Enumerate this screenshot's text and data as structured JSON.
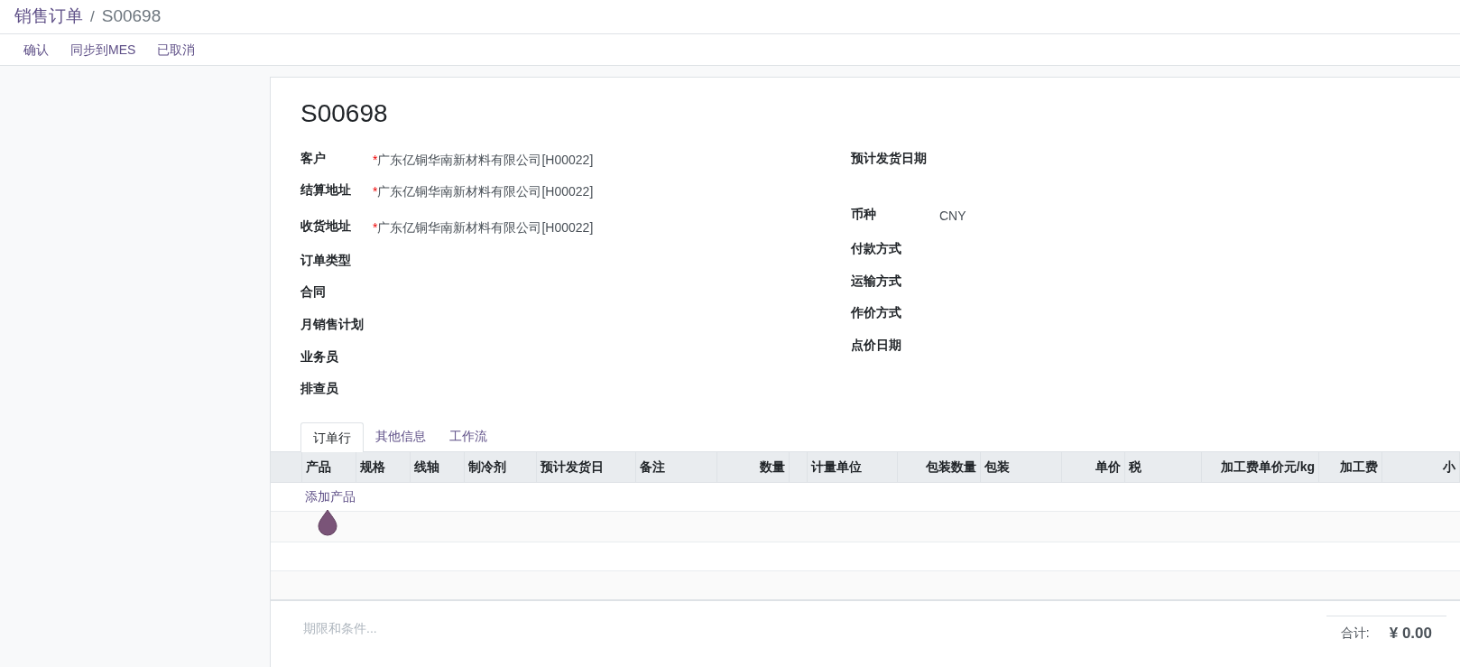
{
  "breadcrumb": {
    "parent": "销售订单",
    "separator": "/",
    "current": "S00698"
  },
  "actions": [
    "确认",
    "同步到MES",
    "已取消"
  ],
  "title": "S00698",
  "left_fields": [
    {
      "label": "客户",
      "required_mark": "*",
      "value": "广东亿铜华南新材料有限公司[H00022]"
    },
    {
      "label": "结算地址",
      "required_mark": "*",
      "value": "广东亿铜华南新材料有限公司[H00022]"
    },
    {
      "label": "收货地址",
      "required_mark": "*",
      "value": "广东亿铜华南新材料有限公司[H00022]"
    },
    {
      "label": "订单类型"
    },
    {
      "label": "合同"
    },
    {
      "label": "月销售计划"
    },
    {
      "label": "业务员"
    },
    {
      "label": "排查员"
    }
  ],
  "right_fields": [
    {
      "label": "预计发货日期"
    },
    {
      "label": "币种",
      "value": "CNY"
    },
    {
      "label": "付款方式"
    },
    {
      "label": "运输方式"
    },
    {
      "label": "作价方式"
    },
    {
      "label": "点价日期"
    }
  ],
  "tabs": [
    {
      "label": "订单行",
      "selected": true
    },
    {
      "label": "其他信息",
      "selected": false
    },
    {
      "label": "工作流",
      "selected": false
    }
  ],
  "table": {
    "columns": [
      "产品",
      "规格",
      "线轴",
      "制冷剂",
      "预计发货日",
      "备注",
      "数量",
      "计量单位",
      "包装数量",
      "包装",
      "单价",
      "税",
      "加工费单价元/kg",
      "加工费",
      "小"
    ],
    "add_link": "添加产品"
  },
  "terms": {
    "placeholder": "期限和条件..."
  },
  "total": {
    "label": "合计:",
    "value": "¥ 0.00"
  }
}
